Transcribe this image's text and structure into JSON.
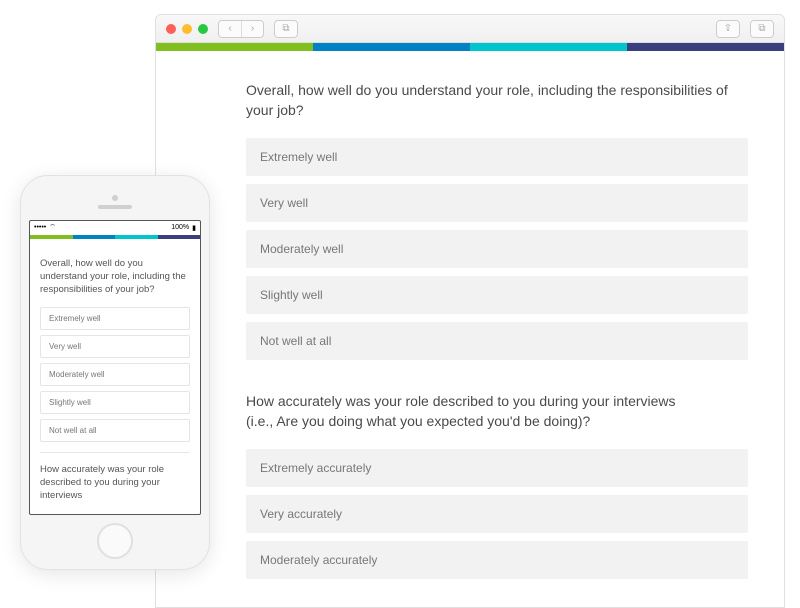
{
  "browser": {
    "chrome": {
      "back": "‹",
      "forward": "›",
      "sidebar": "⧉",
      "share": "⇪",
      "tabs": "⧉"
    },
    "colors": [
      "#80bf1f",
      "#0082c3",
      "#00c5cd",
      "#3b3f7f"
    ]
  },
  "survey": {
    "q1": {
      "title": "Overall, how well do you understand your role, including the responsibilities of your job?",
      "options": [
        "Extremely well",
        "Very well",
        "Moderately well",
        "Slightly well",
        "Not well at all"
      ]
    },
    "q2": {
      "title_line1": "How accurately was your role described to you during your interviews",
      "title_line2": "(i.e., Are you doing what you expected you'd be doing)?",
      "options": [
        "Extremely accurately",
        "Very accurately",
        "Moderately accurately"
      ]
    }
  },
  "phone": {
    "status": {
      "carrier": "•••••",
      "wifi": "⌔",
      "battery_pct": "100%",
      "battery": "▮"
    },
    "q1": {
      "title": "Overall, how well do you understand your role, including the responsibilities of your job?",
      "options": [
        "Extremely well",
        "Very well",
        "Moderately well",
        "Slightly well",
        "Not well at all"
      ]
    },
    "q2_partial": "How accurately was your role described to you during your interviews"
  }
}
